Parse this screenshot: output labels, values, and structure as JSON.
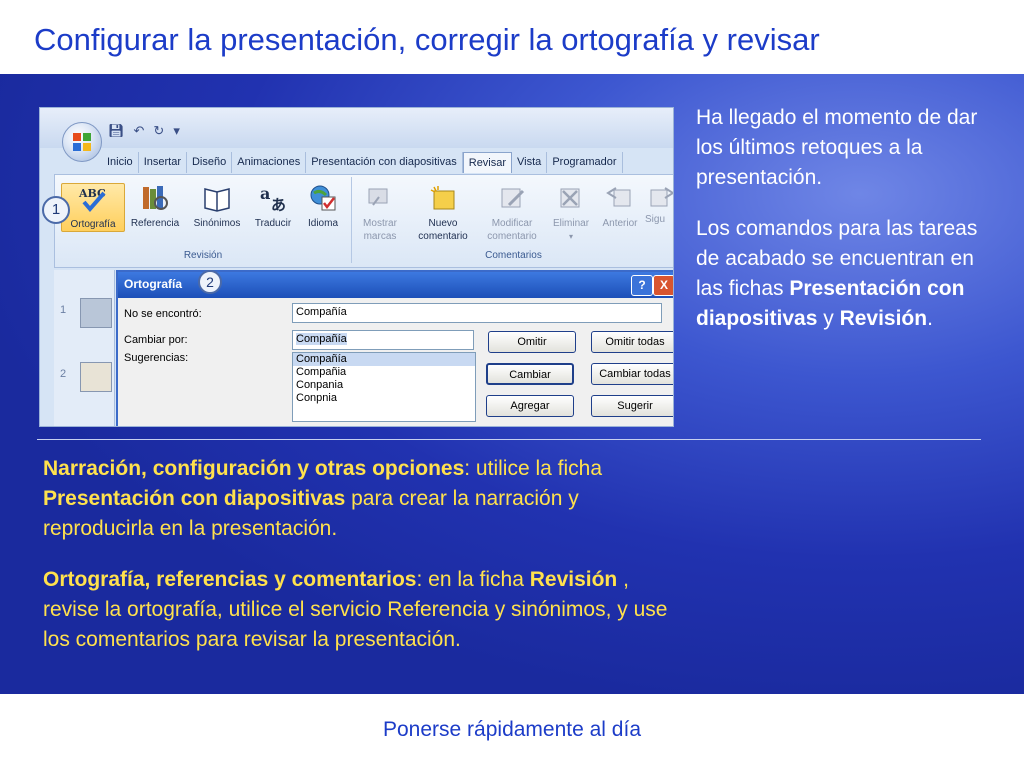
{
  "slide": {
    "title": "Configurar la presentación, corregir la ortografía y revisar",
    "footer": "Ponerse rápidamente al día"
  },
  "screenshot": {
    "ribbon_tabs": [
      "Inicio",
      "Insertar",
      "Diseño",
      "Animaciones",
      "Presentación con diapositivas",
      "Revisar",
      "Vista",
      "Programador"
    ],
    "active_tab": "Revisar",
    "revision_group": {
      "label": "Revisión",
      "buttons": [
        {
          "label": "Ortografía",
          "icon": "abc-check-icon"
        },
        {
          "label": "Referencia",
          "icon": "books-icon"
        },
        {
          "label": "Sinónimos",
          "icon": "book-icon"
        },
        {
          "label": "Traducir",
          "icon": "translate-icon"
        },
        {
          "label": "Idioma",
          "icon": "globe-check-icon"
        }
      ]
    },
    "comments_group": {
      "label": "Comentarios",
      "buttons": [
        {
          "label": "Mostrar marcas",
          "line1": "Mostrar",
          "line2": "marcas"
        },
        {
          "label": "Nuevo comentario",
          "line1": "Nuevo",
          "line2": "comentario"
        },
        {
          "label": "Modificar comentario",
          "line1": "Modificar",
          "line2": "comentario"
        },
        {
          "label": "Eliminar",
          "line1": "Eliminar",
          "line2": ""
        },
        {
          "label": "Anterior",
          "line1": "Anterior",
          "line2": ""
        },
        {
          "label": "Sigu",
          "line1": "Sigu",
          "line2": ""
        }
      ]
    },
    "callouts": [
      "1",
      "2"
    ],
    "slide_thumbs": [
      "1",
      "2"
    ],
    "dialog": {
      "title": "Ortografía",
      "help": "?",
      "close": "X",
      "not_found_label": "No se encontró:",
      "not_found_value": "Compañía",
      "change_to_label": "Cambiar por:",
      "change_to_value": "Compañía",
      "suggestions_label": "Sugerencias:",
      "suggestions": [
        "Compañía",
        "Compañia",
        "Conpania",
        "Conpnia"
      ],
      "buttons": {
        "ignore": "Omitir",
        "ignore_all": "Omitir todas",
        "change": "Cambiar",
        "change_all": "Cambiar todas",
        "add": "Agregar",
        "suggest": "Sugerir"
      }
    }
  },
  "right_panel": {
    "p1": "Ha llegado el momento de dar los últimos retoques a la presentación.",
    "p2_a": "Los comandos para las tareas de acabado se encuentran en las fichas ",
    "p2_b": "Presentación con diapositivas",
    "p2_c": " y ",
    "p2_d": "Revisión",
    "p2_e": "."
  },
  "bottom_panel": {
    "p1_a": "Narración, configuración y otras opciones",
    "p1_b": ": utilice la ficha ",
    "p1_c": "Presentación con diapositivas",
    "p1_d": " para crear la narración y reproducirla en la presentación.",
    "p2_a": "Ortografía, referencias y comentarios",
    "p2_b": ": en la ficha ",
    "p2_c": "Revisión",
    "p2_d": " , revise la ortografía, utilice el servicio Referencia y sinónimos, y use los comentarios para revisar la presentación."
  },
  "colors": {
    "title": "#1c3cc8",
    "band": "#2132b0",
    "highlight": "#ffe14d",
    "text": "#ffffff"
  }
}
